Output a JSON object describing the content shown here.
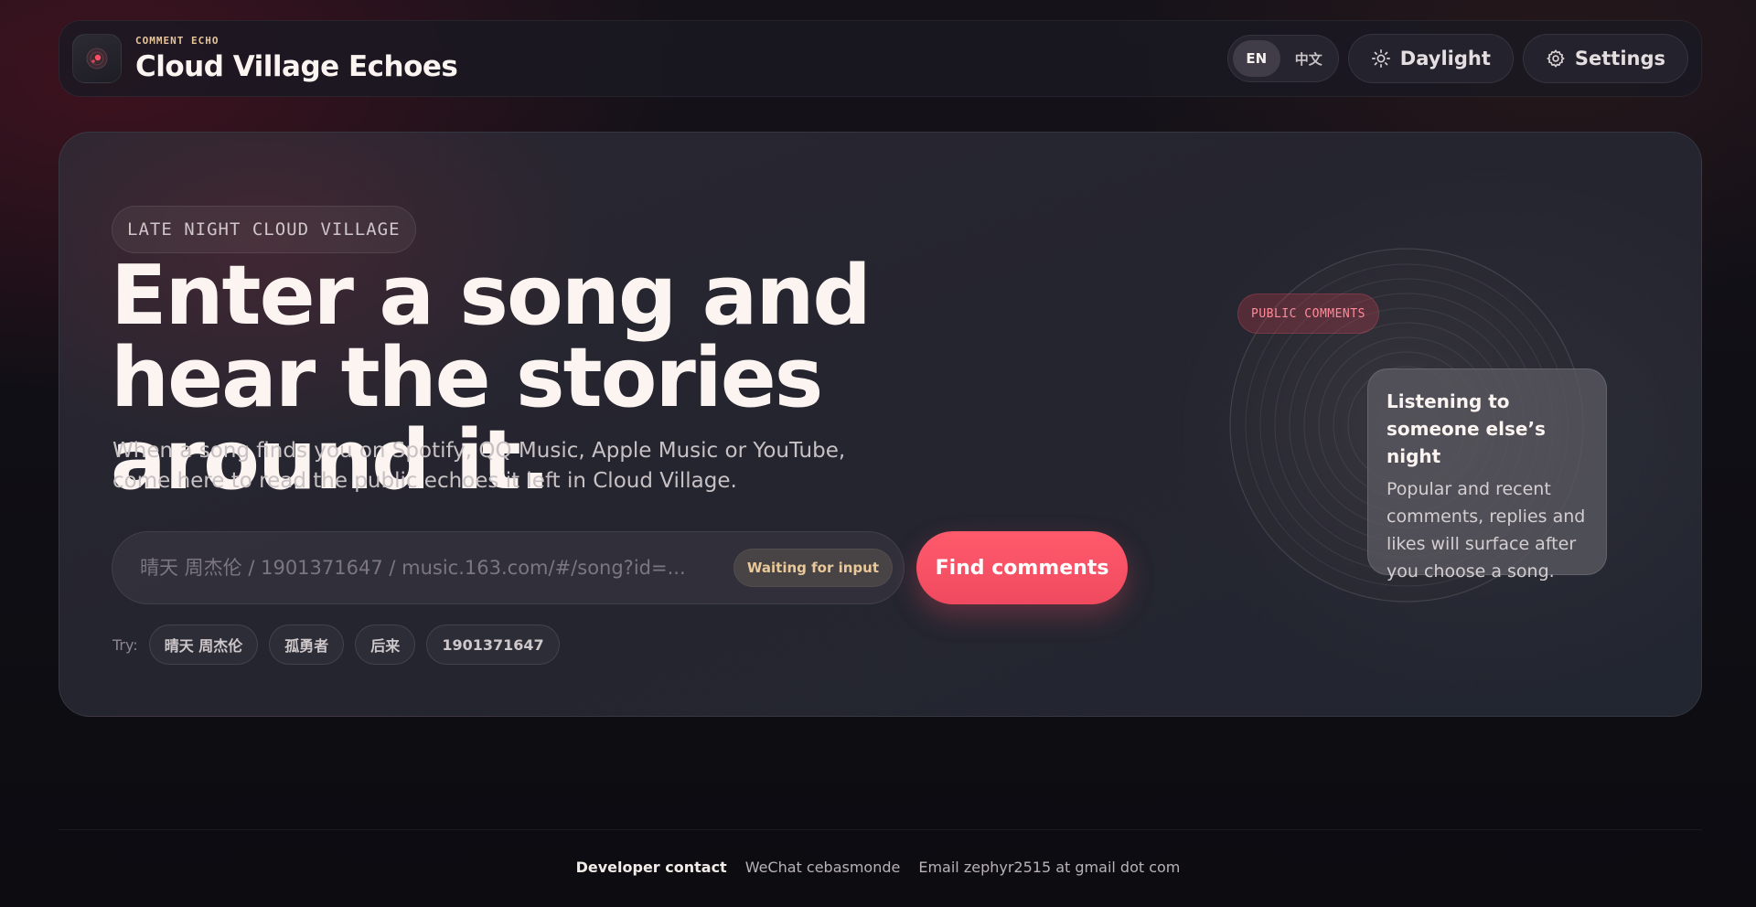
{
  "header": {
    "kicker": "COMMENT ECHO",
    "title": "Cloud Village Echoes",
    "lang_en": "EN",
    "lang_zh": "中文",
    "daylight_label": "Daylight",
    "settings_label": "Settings",
    "icons": {
      "logo": "vinyl-logo-icon",
      "daylight": "sun-icon",
      "settings": "gear-icon"
    }
  },
  "hero": {
    "eyebrow": "LATE NIGHT CLOUD VILLAGE",
    "headline": "Enter a song and hear the stories around it.",
    "subtext_line1": "When a song finds you on Spotify, QQ Music, Apple Music or YouTube,",
    "subtext_line2": "come here to read the public echoes it left in Cloud Village.",
    "search": {
      "placeholder": "晴天 周杰伦 / 1901371647 / music.163.com/#/song?id=...",
      "value": "",
      "status": "Waiting for input"
    },
    "find_label": "Find comments",
    "try_label": "Try:",
    "suggestions": [
      "晴天 周杰伦",
      "孤勇者",
      "后来",
      "1901371647"
    ]
  },
  "illustration": {
    "tag": "PUBLIC COMMENTS",
    "card_title": "Listening to someone else’s night",
    "card_body": "Popular and recent comments, replies and likes will surface after you choose a song."
  },
  "footer": {
    "label": "Developer contact",
    "wechat": "WeChat cebasmonde",
    "email": "Email zephyr2515 at gmail dot com"
  },
  "colors": {
    "accent": "#f5525f",
    "kicker": "#e6c49a",
    "background": "#0f0e14"
  }
}
